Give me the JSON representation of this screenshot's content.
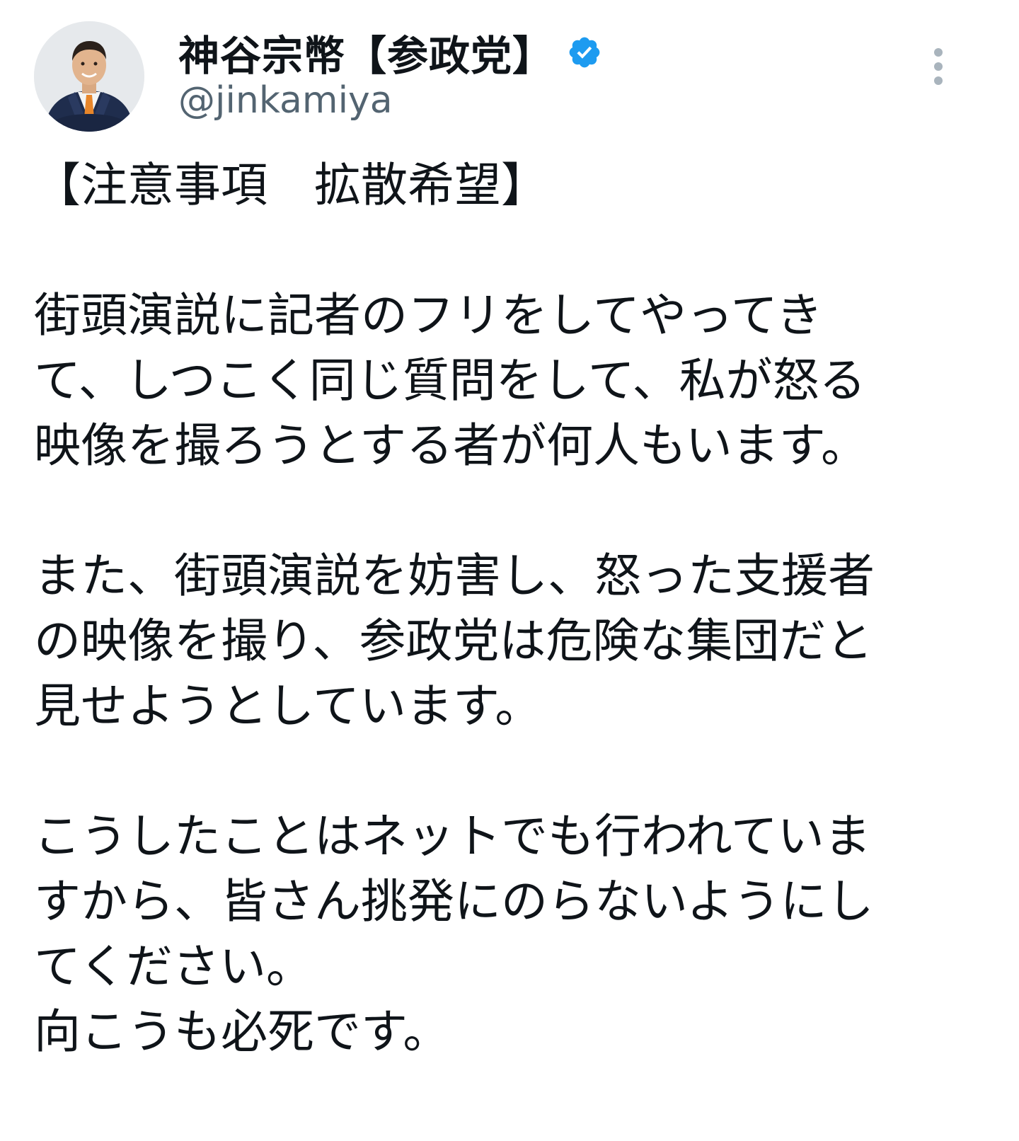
{
  "author": {
    "display_name": "神谷宗幣【参政党】",
    "handle": "@jinkamiya",
    "verified": true,
    "avatar_icon": "profile-photo",
    "verified_icon": "verified-badge-icon",
    "more_icon": "more-options-icon"
  },
  "tweet": {
    "lines": [
      "【注意事項　拡散希望】",
      "",
      "街頭演説に記者のフリをしてやってき",
      "て、しつこく同じ質問をして、私が怒る",
      "映像を撮ろうとする者が何人もいます。",
      "",
      "また、街頭演説を妨害し、怒った支援者",
      "の映像を撮り、参政党は危険な集団だと",
      "見せようとしています。",
      "",
      "こうしたことはネットでも行われていま",
      "すから、皆さん挑発にのらないようにし",
      "てください。",
      "向こうも必死です。"
    ]
  },
  "colors": {
    "text": "#0f1419",
    "secondary_text": "#536471",
    "verified_blue": "#1d9bf0",
    "icon_gray": "#a9b4bd",
    "background": "#ffffff"
  }
}
